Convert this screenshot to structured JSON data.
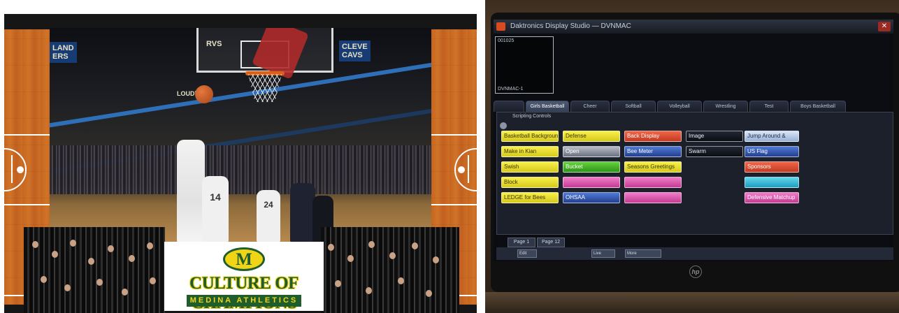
{
  "left_photo": {
    "jumbotron_left": "LAND\nERS",
    "jumbotron_mid": "RVS",
    "jumbotron_right": "CLEVE\nCAVS",
    "arena_sign": "LOUDVILLE",
    "player_numbers": [
      "14",
      "24"
    ],
    "logo": {
      "emblem_letter": "M",
      "headline": "CULTURE OF CHAMPIONS",
      "subline": "MEDINA ATHLETICS",
      "green": "#1f5e2c",
      "gold": "#f0d418"
    }
  },
  "right_photo": {
    "window_title": "Daktronics Display Studio — DVNMAC",
    "preview": {
      "top_label": "001025",
      "bottom_label": "DVNMAC-1"
    },
    "top_tabs": [
      {
        "label": "",
        "active": false
      },
      {
        "label": "Girls Basketball",
        "active": true
      },
      {
        "label": "Cheer",
        "active": false
      },
      {
        "label": "Softball",
        "active": false
      },
      {
        "label": "Volleyball",
        "active": false
      },
      {
        "label": "Wrestling",
        "active": false
      },
      {
        "label": "Test",
        "active": false
      },
      {
        "label": "Boys Basketball",
        "active": false
      }
    ],
    "scripting_label": "Scripting Controls",
    "columns": [
      [
        {
          "label": "Basketball Background",
          "color": "yellow"
        },
        {
          "label": "Make in Kian",
          "color": "yellow"
        },
        {
          "label": "Swish",
          "color": "yellow"
        },
        {
          "label": "Block",
          "color": "yellow"
        },
        {
          "label": "LEDGE for Bees",
          "color": "yellow"
        }
      ],
      [
        {
          "label": "Defense",
          "color": "yellow"
        },
        {
          "label": "Open",
          "color": "grey"
        },
        {
          "label": "Bucket",
          "color": "green"
        },
        {
          "label": "",
          "color": "pink"
        },
        {
          "label": "OHSAA",
          "color": "blue"
        }
      ],
      [
        {
          "label": "Back Display",
          "color": "red"
        },
        {
          "label": "Bee Meter",
          "color": "blue"
        },
        {
          "label": "Seasons Greetings",
          "color": "yellow"
        },
        {
          "label": "",
          "color": "pink"
        },
        {
          "label": "",
          "color": "pink"
        }
      ],
      [
        {
          "label": "Image",
          "color": "black"
        },
        {
          "label": "Swarm",
          "color": "black"
        }
      ],
      [
        {
          "label": "Jump Around &",
          "color": "lightblue"
        },
        {
          "label": "US Flag",
          "color": "blue"
        },
        {
          "label": "Sponsors",
          "color": "red"
        },
        {
          "label": "",
          "color": "cyan"
        },
        {
          "label": "Defensive Matchup",
          "color": "pink"
        }
      ]
    ],
    "page_tabs": [
      "Page 1",
      "Page 12"
    ],
    "bottom_buttons": [
      "Edit",
      "Live",
      "More"
    ],
    "brand_mark": "hp"
  }
}
